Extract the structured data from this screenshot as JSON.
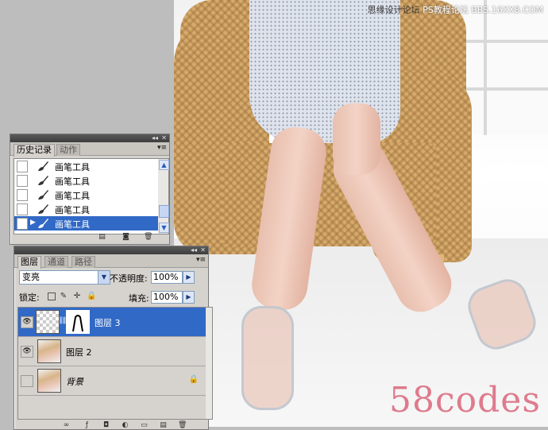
{
  "watermarks": {
    "top_site_cn": "思缘设计论坛",
    "top_site_url": "PS教程论坛 BBS.16XX8.COM",
    "bottom": "58codes"
  },
  "history_panel": {
    "tabs": [
      "历史记录",
      "动作"
    ],
    "active_tab": 0,
    "items": [
      {
        "label": "画笔工具",
        "selected": false
      },
      {
        "label": "画笔工具",
        "selected": false
      },
      {
        "label": "画笔工具",
        "selected": false
      },
      {
        "label": "画笔工具",
        "selected": false
      },
      {
        "label": "画笔工具",
        "selected": true
      }
    ],
    "footer_icons": [
      "new-document-from-state-icon",
      "new-snapshot-icon",
      "trash-icon"
    ]
  },
  "layers_panel": {
    "tabs": [
      "图层",
      "通道",
      "路径"
    ],
    "active_tab": 0,
    "blend_mode": "变亮",
    "opacity_label": "不透明度:",
    "opacity_value": "100%",
    "lock_label": "锁定:",
    "fill_label": "填充:",
    "fill_value": "100%",
    "layers": [
      {
        "name": "图层 3",
        "selected": true,
        "visible": true
      },
      {
        "name": "图层 2",
        "selected": false,
        "visible": true
      },
      {
        "name": "背景",
        "selected": false,
        "visible": false,
        "locked": true
      }
    ]
  }
}
